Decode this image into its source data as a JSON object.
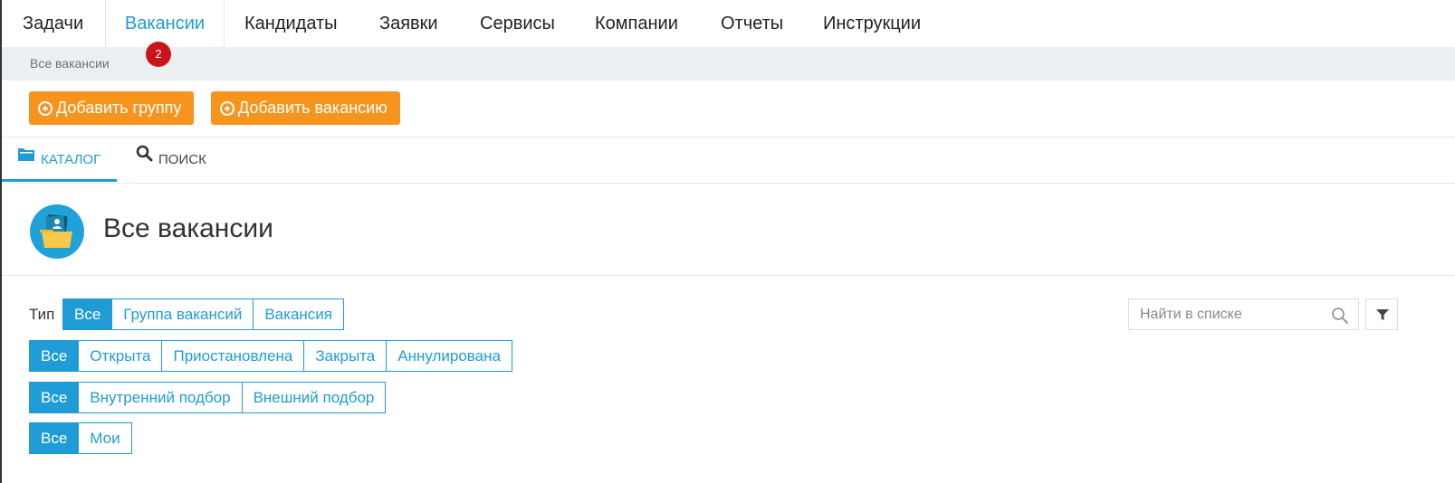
{
  "nav": {
    "items": [
      {
        "label": "Задачи"
      },
      {
        "label": "Вакансии"
      },
      {
        "label": "Кандидаты"
      },
      {
        "label": "Заявки"
      },
      {
        "label": "Сервисы"
      },
      {
        "label": "Компании"
      },
      {
        "label": "Отчеты"
      },
      {
        "label": "Инструкции"
      }
    ],
    "active_index": 1,
    "badge_count": "2"
  },
  "breadcrumb": "Все вакансии",
  "actions": {
    "add_group": "Добавить группу",
    "add_vacancy": "Добавить вакансию"
  },
  "tabs": [
    {
      "label": "КАТАЛОГ",
      "icon": "folder-icon"
    },
    {
      "label": "ПОИСК",
      "icon": "search-icon"
    }
  ],
  "page_title": "Все вакансии",
  "filters": {
    "type_label": "Тип",
    "type": [
      "Все",
      "Группа вакансий",
      "Вакансия"
    ],
    "status": [
      "Все",
      "Открыта",
      "Приостановлена",
      "Закрыта",
      "Аннулирована"
    ],
    "source": [
      "Все",
      "Внутренний подбор",
      "Внешний подбор"
    ],
    "owner": [
      "Все",
      "Мои"
    ]
  },
  "search": {
    "placeholder": "Найти в списке"
  },
  "colors": {
    "accent": "#1f9cd6",
    "action": "#f7941d",
    "badge": "#c8151b"
  }
}
